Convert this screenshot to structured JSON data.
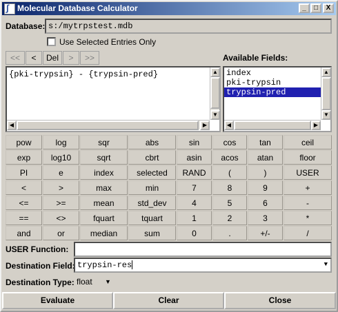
{
  "window": {
    "title": "Molecular Database Calculator",
    "controls": [
      "_",
      "□",
      "X"
    ]
  },
  "database": {
    "label": "Database:",
    "value": "s:/mytrpstest.mdb"
  },
  "use_selected": {
    "label": "Use Selected Entries Only",
    "checked": false
  },
  "nav": {
    "first": "<<",
    "prev": "<",
    "del": "Del",
    "next": ">",
    "last": ">>"
  },
  "expression": {
    "value": "{pki-trypsin} - {trypsin-pred}"
  },
  "available_fields": {
    "label": "Available Fields:",
    "items": [
      "index",
      "pki-trypsin",
      "trypsin-pred"
    ],
    "selected": "trypsin-pred"
  },
  "calc": {
    "rows": [
      [
        "pow",
        "log",
        "sqr",
        "abs",
        "sin",
        "cos",
        "tan",
        "ceil"
      ],
      [
        "exp",
        "log10",
        "sqrt",
        "cbrt",
        "asin",
        "acos",
        "atan",
        "floor"
      ],
      [
        "PI",
        "e",
        "index",
        "selected",
        "RAND",
        "(",
        ")",
        "USER"
      ],
      [
        "<",
        ">",
        "max",
        "min",
        "7",
        "8",
        "9",
        "+"
      ],
      [
        "<=",
        ">=",
        "mean",
        "std_dev",
        "4",
        "5",
        "6",
        "-"
      ],
      [
        "==",
        "<>",
        "fquart",
        "tquart",
        "1",
        "2",
        "3",
        "*"
      ],
      [
        "and",
        "or",
        "median",
        "sum",
        "0",
        ".",
        "+/-",
        "/"
      ]
    ]
  },
  "user_function": {
    "label": "USER Function:",
    "value": ""
  },
  "destination_field": {
    "label": "Destination Field:",
    "value": "trypsin-res"
  },
  "destination_type": {
    "label": "Destination Type:",
    "value": "float"
  },
  "footer": {
    "evaluate": "Evaluate",
    "clear": "Clear",
    "close": "Close"
  }
}
